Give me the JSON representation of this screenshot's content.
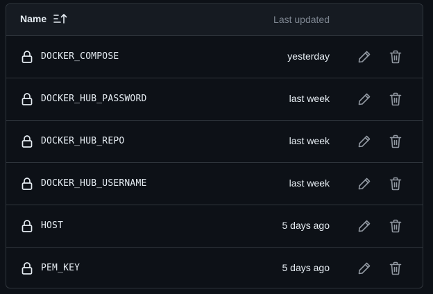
{
  "table": {
    "columns": {
      "name_label": "Name",
      "updated_label": "Last updated"
    },
    "sort_icon": "sort-ascending-icon",
    "rows": [
      {
        "name": "DOCKER_COMPOSE",
        "updated": "yesterday"
      },
      {
        "name": "DOCKER_HUB_PASSWORD",
        "updated": "last week"
      },
      {
        "name": "DOCKER_HUB_REPO",
        "updated": "last week"
      },
      {
        "name": "DOCKER_HUB_USERNAME",
        "updated": "last week"
      },
      {
        "name": "HOST",
        "updated": "5 days ago"
      },
      {
        "name": "PEM_KEY",
        "updated": "5 days ago"
      }
    ],
    "row_icons": {
      "lock": "lock-icon",
      "edit": "pencil-icon",
      "delete": "trash-icon"
    }
  },
  "colors": {
    "background": "#0d1117",
    "header_background": "#161b22",
    "border": "#30363d",
    "text": "#e6edf3",
    "muted_text": "#7d8590",
    "icon": "#9198a1"
  }
}
